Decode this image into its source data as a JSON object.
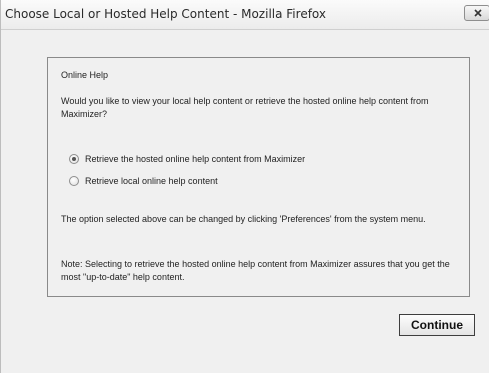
{
  "window": {
    "title": "Choose Local or Hosted Help Content - Mozilla Firefox"
  },
  "dialog": {
    "section_title": "Online Help",
    "question": "Would you like to view your local help content or retrieve the hosted online help content from Maximizer?",
    "options": [
      {
        "label": "Retrieve the hosted online help content from Maximizer",
        "selected": true
      },
      {
        "label": "Retrieve local online help content",
        "selected": false
      }
    ],
    "preferences_note": "The option selected above can be changed by clicking 'Preferences' from the system menu.",
    "hosted_note": "Note: Selecting to retrieve the hosted online help content from Maximizer assures that you get the most \"up-to-date\" help content.",
    "continue_label": "Continue"
  }
}
